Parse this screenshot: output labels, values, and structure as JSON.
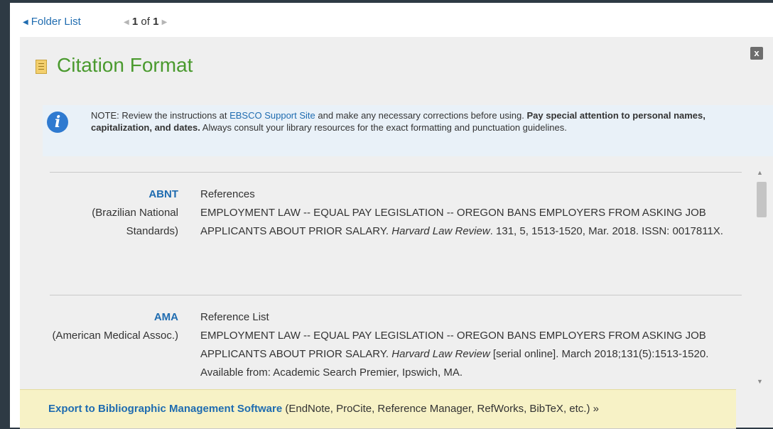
{
  "nav": {
    "folder_list": "Folder List",
    "page_current": "1",
    "page_of": "of",
    "page_total": "1"
  },
  "dialog": {
    "title": "Citation Format",
    "close_label": "x"
  },
  "note": {
    "prefix": "NOTE: Review the instructions at ",
    "link": "EBSCO Support Site",
    "middle": " and make any necessary corrections before using. ",
    "bold": "Pay special attention to personal names, capitalization, and dates.",
    "suffix": " Always consult your library resources for the exact formatting and punctuation guidelines."
  },
  "citations": [
    {
      "code": "ABNT",
      "name": "(Brazilian National Standards)",
      "heading": "References",
      "text_before": "EMPLOYMENT LAW -- EQUAL PAY LEGISLATION -- OREGON BANS EMPLOYERS FROM ASKING JOB APPLICANTS ABOUT PRIOR SALARY. ",
      "journal": "Harvard Law Review",
      "text_after": ". 131, 5, 1513-1520, Mar. 2018. ISSN: 0017811X."
    },
    {
      "code": "AMA",
      "name": "(American Medical Assoc.)",
      "heading": "Reference List",
      "text_before": "EMPLOYMENT LAW -- EQUAL PAY LEGISLATION -- OREGON BANS EMPLOYERS FROM ASKING JOB APPLICANTS ABOUT PRIOR SALARY. ",
      "journal": "Harvard Law Review",
      "text_after": " [serial online]. March 2018;131(5):1513-1520. Available from: Academic Search Premier, Ipswich, MA."
    }
  ],
  "export": {
    "link": "Export to Bibliographic Management Software",
    "suffix": " (EndNote, ProCite, Reference Manager, RefWorks, BibTeX, etc.) »"
  },
  "colors": {
    "link": "#1f6cb0",
    "title": "#4a9a2e",
    "note_bg": "#e9f1f8",
    "export_bg": "#f7f2c6",
    "info_icon": "#2f7ad0"
  },
  "icons": {
    "title": "document-icon",
    "note": "info-icon",
    "close": "close-icon"
  }
}
